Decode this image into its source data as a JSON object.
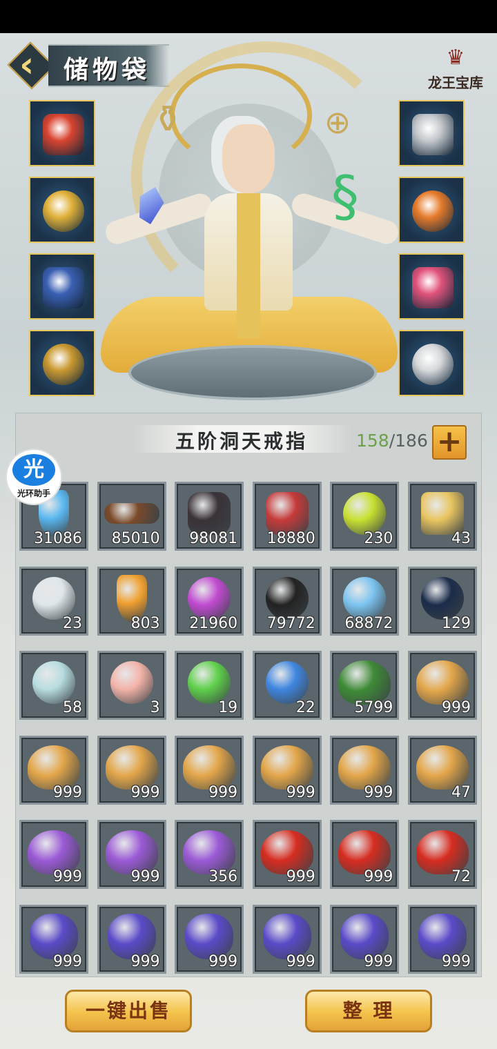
{
  "header": {
    "title": "储物袋",
    "treasury_label": "龙王宝库"
  },
  "bag": {
    "name": "五阶洞天戒指",
    "used": "158",
    "separator": "/",
    "total": "186",
    "add_label": "+"
  },
  "assistant_badge": {
    "glyph": "光",
    "label": "光环助手"
  },
  "equipment_left": [
    {
      "name": "sword",
      "color": "#d8432f"
    },
    {
      "name": "lion-helmet",
      "color": "#e0b038"
    },
    {
      "name": "armor",
      "color": "#3a5fb2"
    },
    {
      "name": "boots",
      "color": "#c9982f"
    }
  ],
  "equipment_right": [
    {
      "name": "ring",
      "color": "#c4c8cc"
    },
    {
      "name": "amulet",
      "color": "#e57a2a"
    },
    {
      "name": "bracelet",
      "color": "#e0527a"
    },
    {
      "name": "shield-medal",
      "color": "#d6d8da"
    }
  ],
  "items": [
    {
      "icon": "blue-crystal",
      "color": "#5ab8f0",
      "count": "31086"
    },
    {
      "icon": "wood-log",
      "color": "#7a4a2a",
      "count": "85010"
    },
    {
      "icon": "dark-ore",
      "color": "#3a3238",
      "count": "98081"
    },
    {
      "icon": "red-emblem",
      "color": "#c63a3a",
      "count": "18880"
    },
    {
      "icon": "green-orb",
      "color": "#c8e030",
      "count": "230"
    },
    {
      "icon": "gift-box",
      "color": "#e8c560",
      "count": "43"
    },
    {
      "icon": "white-vase",
      "color": "#dfe6ea",
      "count": "23"
    },
    {
      "icon": "amber-shard",
      "color": "#f0a030",
      "count": "803"
    },
    {
      "icon": "purple-orb",
      "color": "#c04ad0",
      "count": "21960"
    },
    {
      "icon": "black-droplet",
      "color": "#222222",
      "count": "79772"
    },
    {
      "icon": "blue-droplet",
      "color": "#7cc4f0",
      "count": "68872"
    },
    {
      "icon": "dark-pearl",
      "color": "#1b2c4a",
      "count": "129"
    },
    {
      "icon": "potion-bottle",
      "color": "#b8dde0",
      "count": "58"
    },
    {
      "icon": "pink-potion",
      "color": "#f3b3a8",
      "count": "3"
    },
    {
      "icon": "green-gem",
      "color": "#5fd04a",
      "count": "19"
    },
    {
      "icon": "blue-gem",
      "color": "#3f86e0",
      "count": "22"
    },
    {
      "icon": "green-herb",
      "color": "#3e8a36",
      "count": "5799"
    },
    {
      "icon": "spider-lily",
      "color": "#e3a64a",
      "count": "999"
    },
    {
      "icon": "spider-lily",
      "color": "#e3a64a",
      "count": "999"
    },
    {
      "icon": "spider-lily",
      "color": "#e3a64a",
      "count": "999"
    },
    {
      "icon": "spider-lily",
      "color": "#e3a64a",
      "count": "999"
    },
    {
      "icon": "spider-lily",
      "color": "#e3a64a",
      "count": "999"
    },
    {
      "icon": "spider-lily",
      "color": "#e3a64a",
      "count": "999"
    },
    {
      "icon": "spider-lily",
      "color": "#e3a64a",
      "count": "47"
    },
    {
      "icon": "purple-flower",
      "color": "#9b5ad6",
      "count": "999"
    },
    {
      "icon": "purple-flower",
      "color": "#9b5ad6",
      "count": "999"
    },
    {
      "icon": "purple-flower",
      "color": "#9b5ad6",
      "count": "356"
    },
    {
      "icon": "red-flower",
      "color": "#d62c20",
      "count": "999"
    },
    {
      "icon": "red-flower",
      "color": "#d62c20",
      "count": "999"
    },
    {
      "icon": "red-flower",
      "color": "#d62c20",
      "count": "72"
    },
    {
      "icon": "grape-cluster",
      "color": "#5a4ac8",
      "count": "999"
    },
    {
      "icon": "grape-cluster",
      "color": "#5a4ac8",
      "count": "999"
    },
    {
      "icon": "grape-cluster",
      "color": "#5a4ac8",
      "count": "999"
    },
    {
      "icon": "grape-cluster",
      "color": "#5a4ac8",
      "count": "999"
    },
    {
      "icon": "grape-cluster",
      "color": "#5a4ac8",
      "count": "999"
    },
    {
      "icon": "grape-cluster",
      "color": "#5a4ac8",
      "count": "999"
    }
  ],
  "actions": {
    "sell_all": "一键出售",
    "sort": "整 理"
  }
}
